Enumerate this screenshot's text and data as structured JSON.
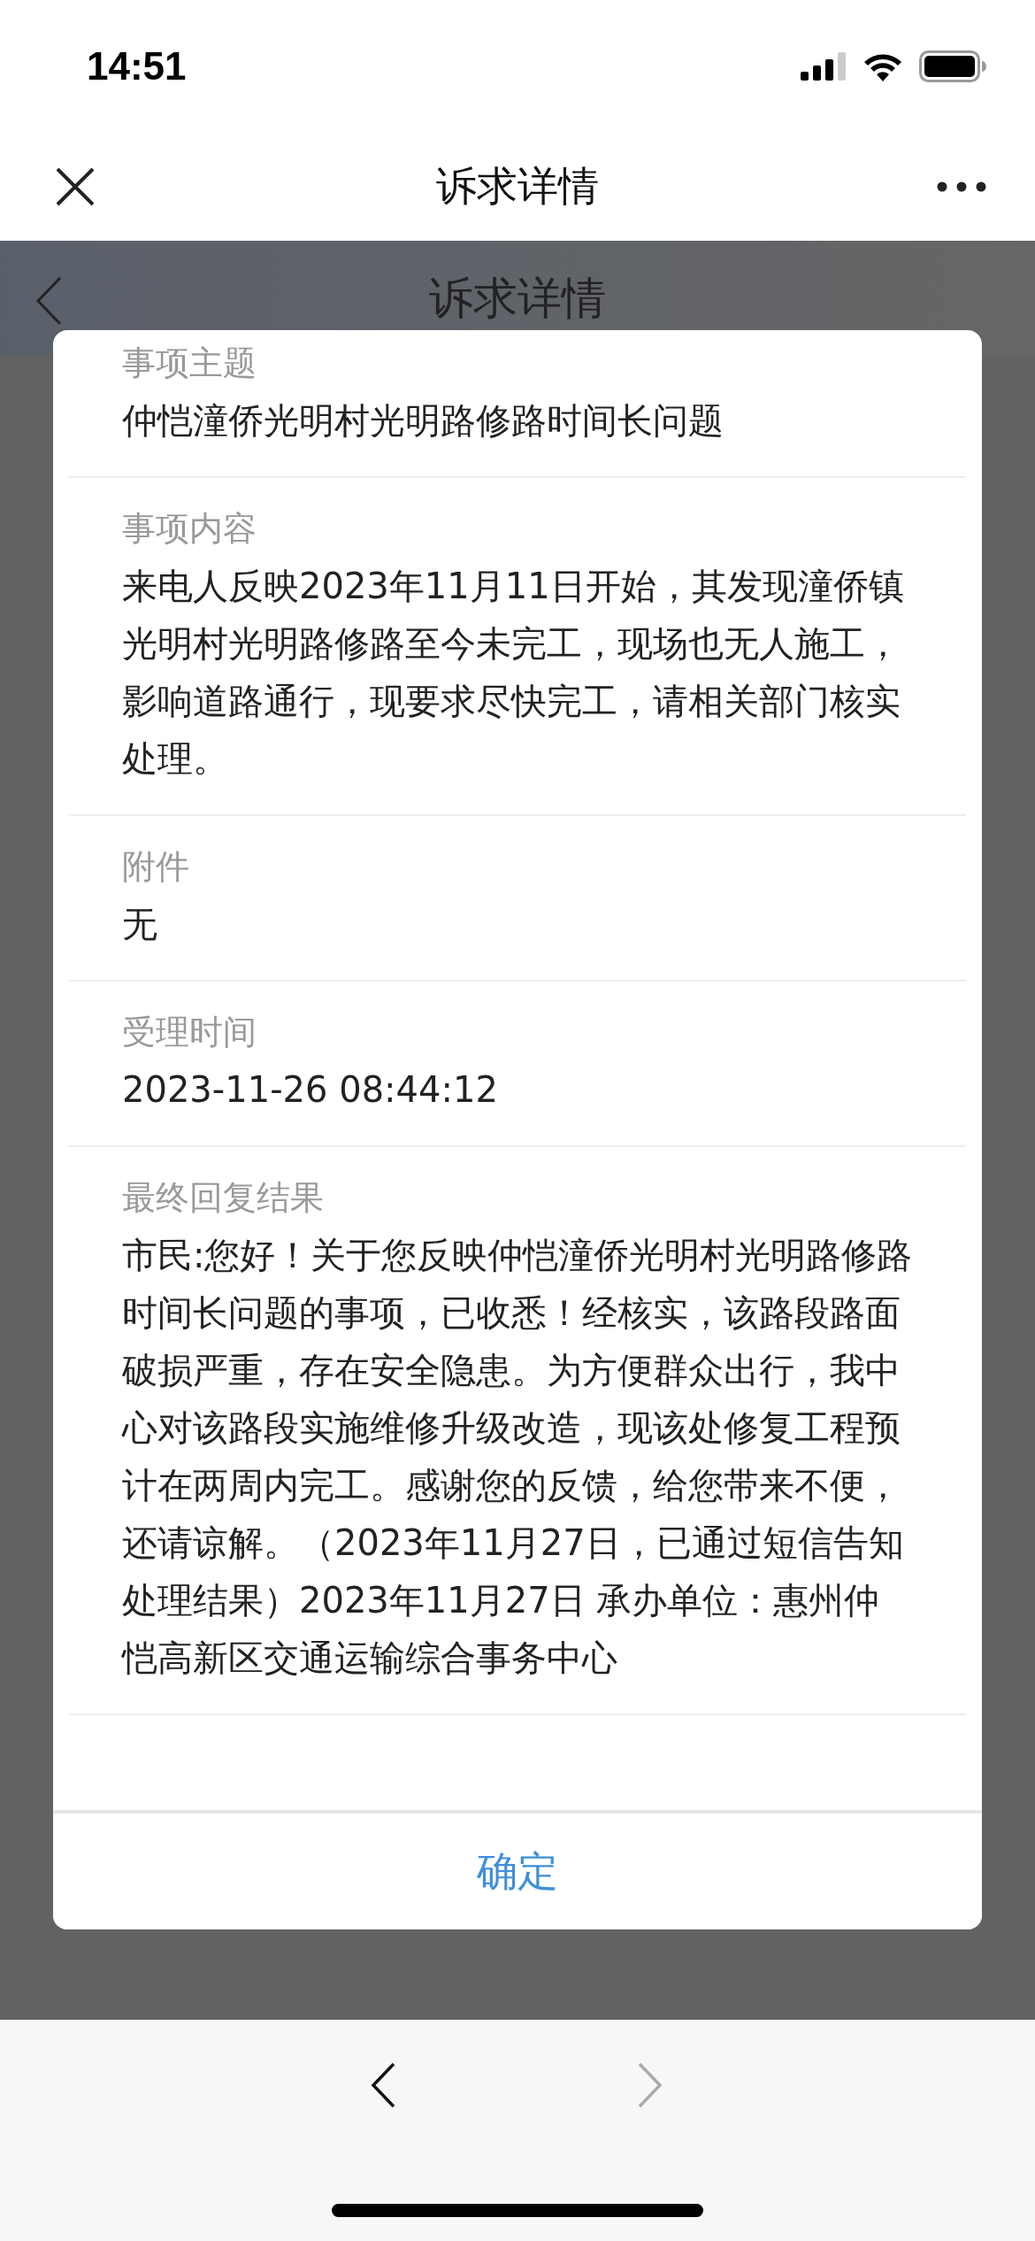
{
  "status_bar": {
    "time": "14:51"
  },
  "nav_bar": {
    "title": "诉求详情"
  },
  "background_page": {
    "title": "诉求详情"
  },
  "dialog": {
    "fields": [
      {
        "label": "事项主题",
        "value": "仲恺潼侨光明村光明路修路时间长问题"
      },
      {
        "label": "事项内容",
        "value": "来电人反映2023年11月11日开始，其发现潼侨镇光明村光明路修路至今未完工，现场也无人施工，影响道路通行，现要求尽快完工，请相关部门核实处理。"
      },
      {
        "label": "附件",
        "value": "无"
      },
      {
        "label": "受理时间",
        "value": "2023-11-26 08:44:12"
      },
      {
        "label": "最终回复结果",
        "value": "市民:您好！关于您反映仲恺潼侨光明村光明路修路时间长问题的事项，已收悉！经核实，该路段路面破损严重，存在安全隐患。为方便群众出行，我中心对该路段实施维修升级改造，现该处修复工程预计在两周内完工。感谢您的反馈，给您带来不便，还请谅解。（2023年11月27日，已通过短信告知处理结果）2023年11月27日 承办单位：惠州仲恺高新区交通运输综合事务中心"
      }
    ],
    "confirm_button": "确定"
  },
  "toolbar": {
    "back": {
      "disabled": false
    },
    "forward": {
      "disabled": true
    }
  }
}
